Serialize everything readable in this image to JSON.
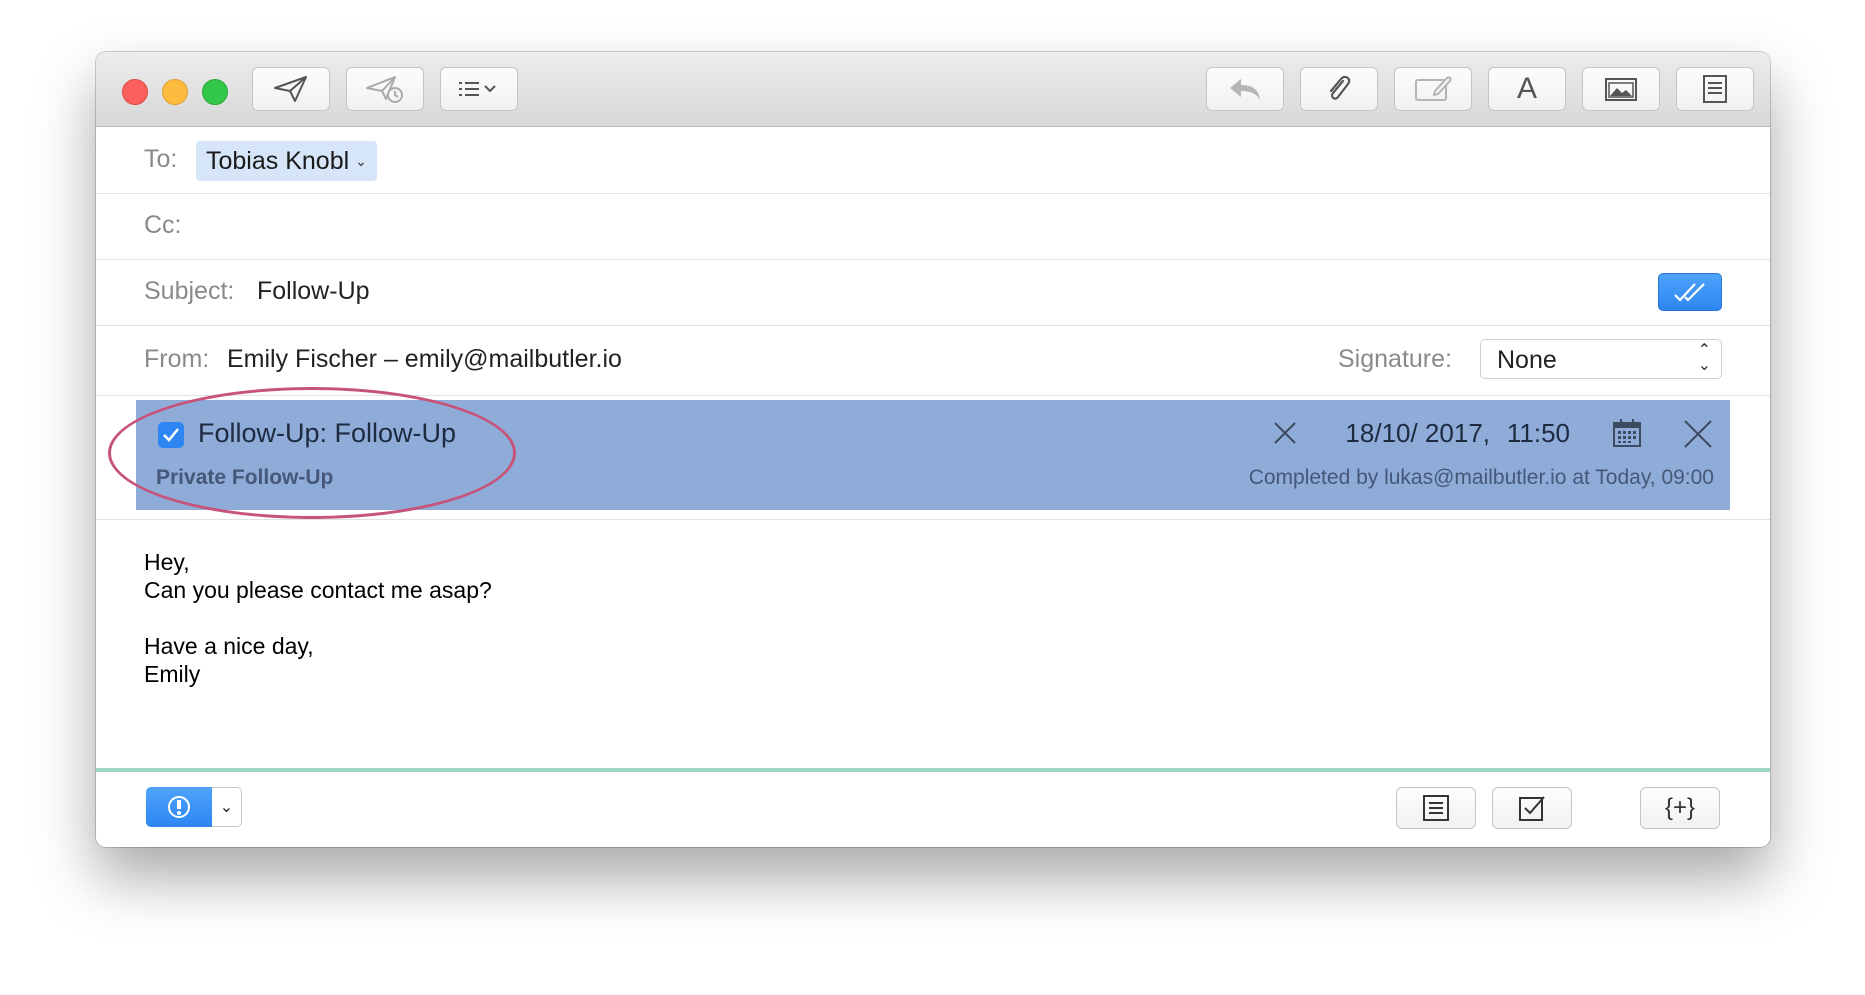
{
  "toolbar": {
    "left_buttons": [
      "send-icon",
      "send-later-icon",
      "format-list-icon"
    ],
    "right_buttons": [
      "reply-icon",
      "attach-icon",
      "annotate-icon",
      "font-icon",
      "photo-browser-icon",
      "template-icon"
    ],
    "font_glyph": "A"
  },
  "header": {
    "to_label": "To:",
    "to_value": "Tobias Knobl",
    "cc_label": "Cc:",
    "subject_label": "Subject:",
    "subject_value": "Follow-Up",
    "from_label": "From:",
    "from_value": "Emily Fischer – emily@mailbutler.io",
    "signature_label": "Signature:",
    "signature_value": "None"
  },
  "followup": {
    "title": "Follow-Up: Follow-Up",
    "subtitle": "Private Follow-Up",
    "date": "18/10/ 2017,",
    "time": "11:50",
    "completed": "Completed by lukas@mailbutler.io at Today, 09:00",
    "checked": true
  },
  "body": {
    "lines": [
      "Hey,",
      "Can you please contact me asap?",
      "",
      "Have a nice day,",
      "Emily"
    ]
  },
  "bottom": {
    "placeholder_glyph": "{+}"
  },
  "colors": {
    "followup_bg": "#8fabd8",
    "accent_blue": "#2d86f2",
    "highlight_ring": "#c65479",
    "divider": "#9fd8c4"
  }
}
